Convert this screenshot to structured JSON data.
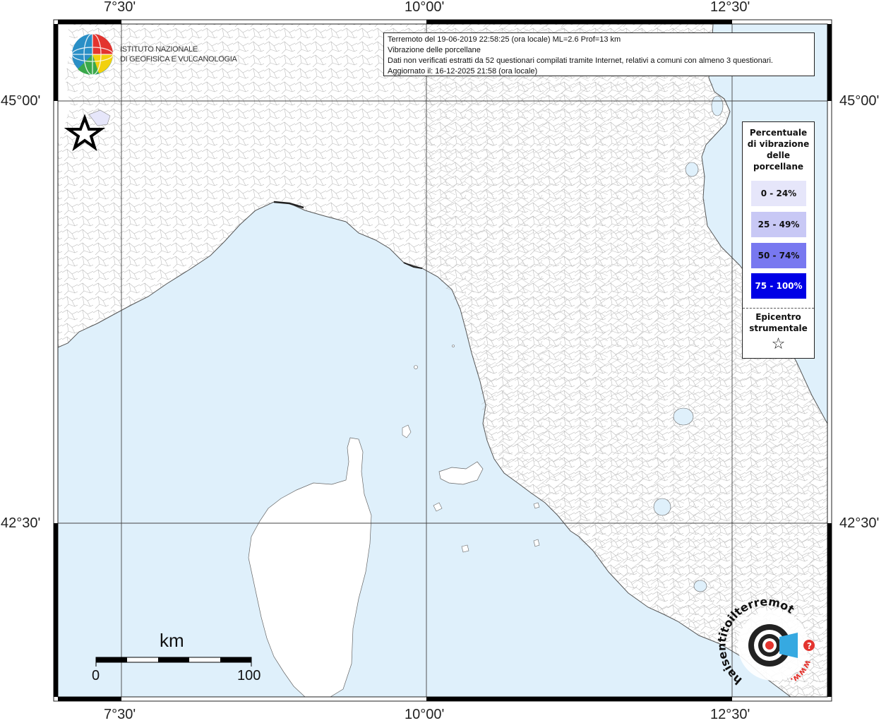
{
  "header": {
    "line1": "Terremoto del 19-06-2019 22:58:25 (ora locale) ML=2.6 Prof=13 km",
    "line2": "Vibrazione delle porcellane",
    "line3": "Dati non verificati estratti da 52 questionari compilati tramite Internet, relativi a comuni con almeno 3 questionari.",
    "line4": "Aggiornato il: 16-12-2025 21:58 (ora locale)"
  },
  "logo_ingv": {
    "line1": "ISTITUTO NAZIONALE",
    "line2": "DI GEOFISICA E VULCANOLOGIA"
  },
  "axes": {
    "lon_ticks": [
      "7°30'",
      "10°00'",
      "12°30'"
    ],
    "lat_ticks": [
      "45°00'",
      "42°30'"
    ]
  },
  "legend": {
    "title_lines": [
      "Percentuale",
      "di vibrazione",
      "delle",
      "porcellane"
    ],
    "items": [
      {
        "label": "0 - 24%",
        "color": "#e6e6fa",
        "text_color": "#111111"
      },
      {
        "label": "25 - 49%",
        "color": "#c8c8f5",
        "text_color": "#111111"
      },
      {
        "label": "50 - 74%",
        "color": "#7878f0",
        "text_color": "#111111"
      },
      {
        "label": "75 - 100%",
        "color": "#0000e6",
        "text_color": "#ffffff"
      }
    ],
    "epicenter_lines": [
      "Epicentro",
      "strumentale"
    ],
    "epicenter_symbol": "☆"
  },
  "scale_bar": {
    "unit": "km",
    "min_label": "0",
    "max_label": "100"
  },
  "logo_hsit": {
    "text": "haisentitoilterremoto.it",
    "prefix": "www.",
    "icon": "earthquake-target-icon"
  },
  "colors": {
    "sea": "#dff0fb",
    "land": "#ffffff",
    "border": "#999999"
  }
}
